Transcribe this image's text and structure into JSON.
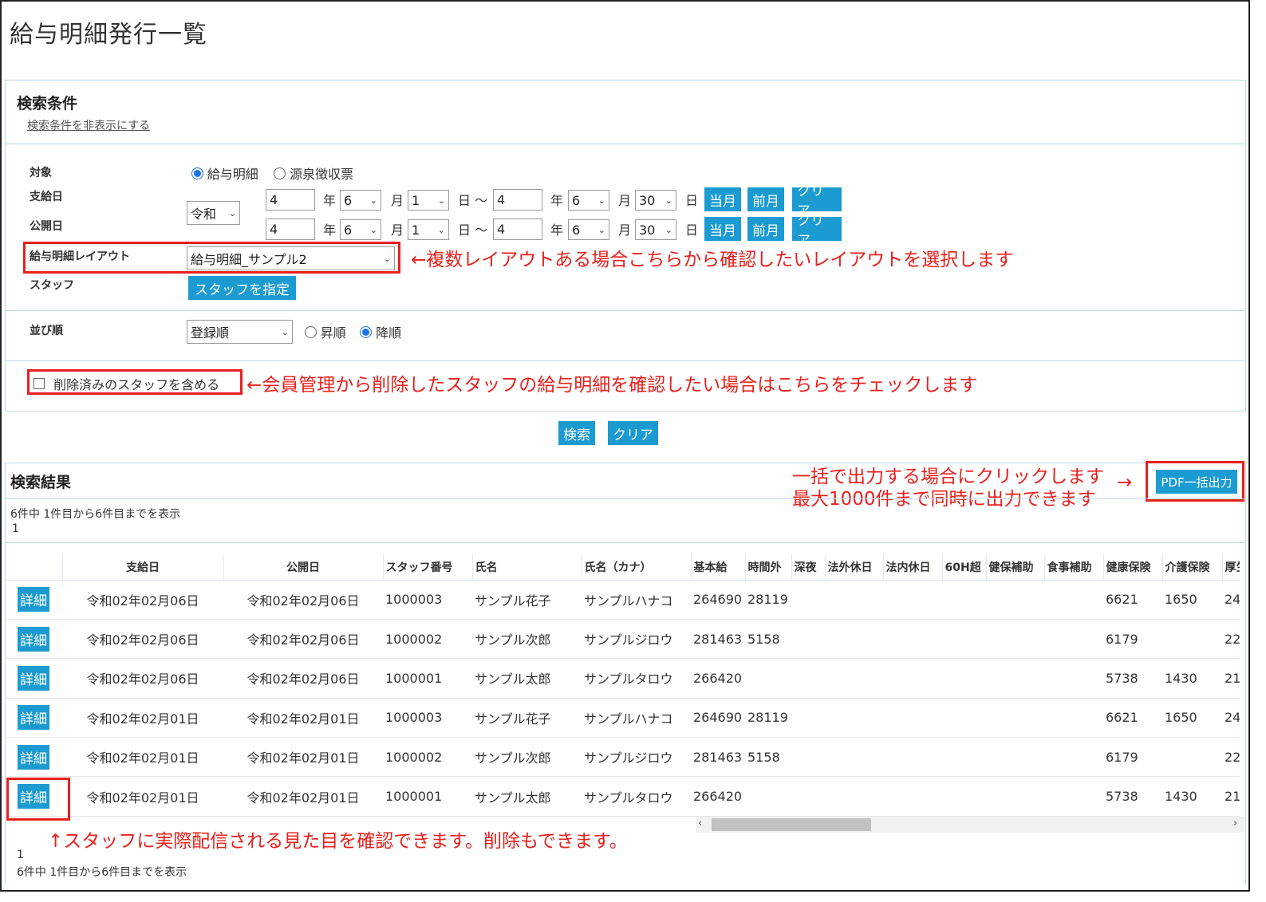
{
  "page": {
    "title": "給与明細発行一覧"
  },
  "search": {
    "title": "検索条件",
    "hide_link": "検索条件を非表示にする",
    "target": {
      "label": "対象",
      "options": [
        "給与明細",
        "源泉徴収票"
      ],
      "selected": "給与明細"
    },
    "era": "令和",
    "pay_date": {
      "label": "支給日",
      "from": {
        "year": "4",
        "month": "6",
        "day": "1"
      },
      "to": {
        "year": "4",
        "month": "6",
        "day": "30"
      }
    },
    "publish_date": {
      "label": "公開日",
      "from": {
        "year": "4",
        "month": "6",
        "day": "1"
      },
      "to": {
        "year": "4",
        "month": "6",
        "day": "30"
      }
    },
    "units": {
      "year": "年",
      "month": "月",
      "day": "日",
      "tilde": "〜"
    },
    "buttons": {
      "this_month": "当月",
      "prev_month": "前月",
      "clear": "クリア"
    },
    "layout": {
      "label": "給与明細レイアウト",
      "selected": "給与明細_サンプル2"
    },
    "staff": {
      "label": "スタッフ",
      "button": "スタッフを指定"
    },
    "order": {
      "label": "並び順",
      "selected": "登録順",
      "options": [
        "昇順",
        "降順"
      ],
      "checked": "降順"
    },
    "include_deleted": "削除済みのスタッフを含める",
    "submit": "検索",
    "reset": "クリア"
  },
  "annotations": {
    "layout_note": "←複数レイアウトある場合こちらから確認したいレイアウトを選択します",
    "deleted_note": "←会員管理から削除したスタッフの給与明細を確認したい場合はこちらをチェックします",
    "pdf_note_1": "一括で出力する場合にクリックします",
    "pdf_note_2": "最大1000件まで同時に出力できます",
    "pdf_arrow": "→",
    "detail_note": "↑スタッフに実際配信される見た目を確認できます。削除もできます。"
  },
  "results": {
    "title": "検索結果",
    "pdf_button": "PDF一括出力",
    "summary": "6件中 1件目から6件目までを表示",
    "page": "1",
    "detail_label": "詳細",
    "columns": [
      "",
      "支給日",
      "公開日",
      "スタッフ番号",
      "氏名",
      "氏名（カナ）",
      "基本給",
      "時間外",
      "深夜",
      "法外休日",
      "法内休日",
      "60H超",
      "健保補助",
      "食事補助",
      "健康保険",
      "介護保険",
      "厚生"
    ],
    "rows": [
      {
        "pay": "令和02年02月06日",
        "pub": "令和02年02月06日",
        "no": "1000003",
        "name": "サンプル花子",
        "kana": "サンプルハナコ",
        "base": "264690",
        "ot": "28119",
        "health": "6621",
        "care": "1650",
        "welfare": "24"
      },
      {
        "pay": "令和02年02月06日",
        "pub": "令和02年02月06日",
        "no": "1000002",
        "name": "サンプル次郎",
        "kana": "サンプルジロウ",
        "base": "281463",
        "ot": "5158",
        "health": "6179",
        "care": "",
        "welfare": "22"
      },
      {
        "pay": "令和02年02月06日",
        "pub": "令和02年02月06日",
        "no": "1000001",
        "name": "サンプル太郎",
        "kana": "サンプルタロウ",
        "base": "266420",
        "ot": "",
        "health": "5738",
        "care": "1430",
        "welfare": "21"
      },
      {
        "pay": "令和02年02月01日",
        "pub": "令和02年02月01日",
        "no": "1000003",
        "name": "サンプル花子",
        "kana": "サンプルハナコ",
        "base": "264690",
        "ot": "28119",
        "health": "6621",
        "care": "1650",
        "welfare": "24"
      },
      {
        "pay": "令和02年02月01日",
        "pub": "令和02年02月01日",
        "no": "1000002",
        "name": "サンプル次郎",
        "kana": "サンプルジロウ",
        "base": "281463",
        "ot": "5158",
        "health": "6179",
        "care": "",
        "welfare": "22"
      },
      {
        "pay": "令和02年02月01日",
        "pub": "令和02年02月01日",
        "no": "1000001",
        "name": "サンプル太郎",
        "kana": "サンプルタロウ",
        "base": "266420",
        "ot": "",
        "health": "5738",
        "care": "1430",
        "welfare": "21"
      }
    ]
  }
}
